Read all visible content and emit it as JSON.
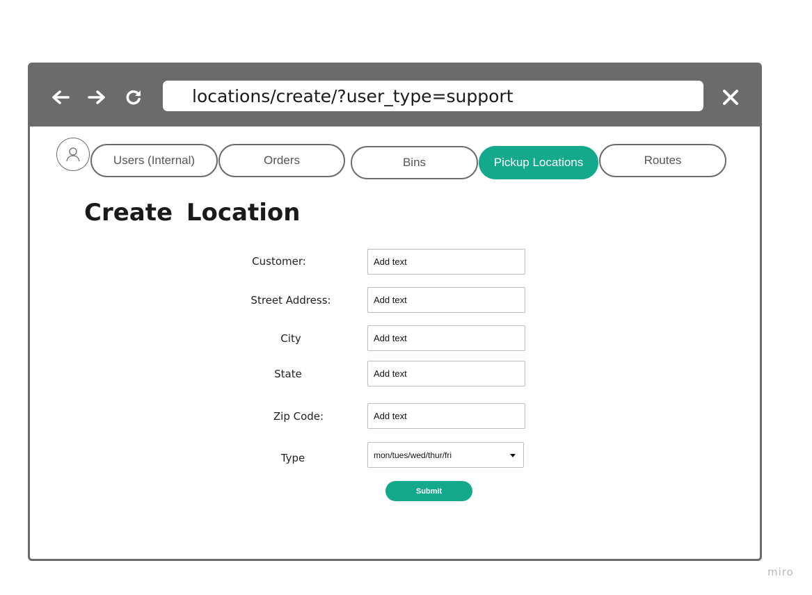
{
  "browser": {
    "url": "locations/create/?user_type=support",
    "icons": {
      "back": "arrow-left-icon",
      "forward": "arrow-right-icon",
      "reload": "reload-icon",
      "close": "close-icon"
    }
  },
  "nav": {
    "avatar_icon": "user-icon",
    "tabs": [
      {
        "label": "Users (Internal)",
        "active": false
      },
      {
        "label": "Orders",
        "active": false
      },
      {
        "label": "Bins",
        "active": false
      },
      {
        "label": "Pickup Locations",
        "active": true
      },
      {
        "label": "Routes",
        "active": false
      }
    ]
  },
  "page": {
    "title": "Create  Location"
  },
  "form": {
    "fields": [
      {
        "label": "Customer:",
        "placeholder": "Add text"
      },
      {
        "label": "Street Address:",
        "placeholder": "Add text"
      },
      {
        "label": "City",
        "placeholder": "Add text"
      },
      {
        "label": "State",
        "placeholder": "Add text"
      },
      {
        "label": "Zip Code:",
        "placeholder": "Add text"
      }
    ],
    "type_field": {
      "label": "Type",
      "selected": "mon/tues/wed/thur/fri"
    },
    "submit_label": "Submit"
  },
  "watermark": "miro",
  "colors": {
    "accent": "#13a98a",
    "chrome": "#6b6b6b"
  }
}
